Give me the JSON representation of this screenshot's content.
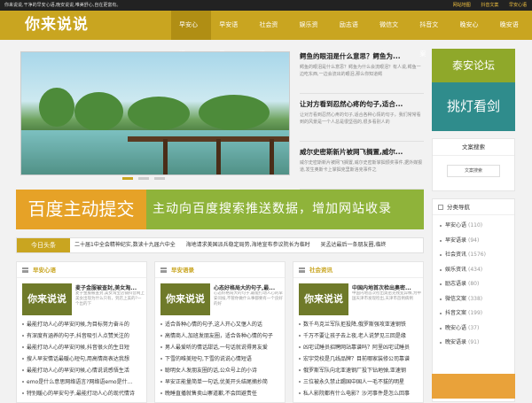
{
  "topbar": {
    "text": "你来说说,干净的早安心语,晚安说说,唯美舒心,自在更富有。",
    "links": [
      "网站地图",
      "抖音文案",
      "早安心语"
    ]
  },
  "logo": "你来说说",
  "nav": [
    "早安心语",
    "早安语录",
    "社会资讯",
    "娱乐资讯",
    "励志语录",
    "微信文案",
    "抖音文案",
    "晚安心语",
    "晚安语录"
  ],
  "news": [
    {
      "title": "鳄鱼的眼泪是什么意思？鳄鱼为...",
      "desc": "鳄鱼的眼泪是什么意思？鳄鱼为什么会流眼泪？有人说,鳄鱼一边吃东西,一边会流出的眼泪,那么你知道鳄"
    },
    {
      "title": "让对方看到忍然心疼的句子,适合...",
      "desc": "让对方看到忍然心疼的句子,适合各种心情的句子，我们常常看到的风景是一个人总是很坚强的,很多看别人的"
    },
    {
      "title": "威尔史密斯新片被网飞搁置,威尔...",
      "desc": "威尔史密斯新片被网飞搁置,威尔史密斯掌掴颁奖事件,据外媒报道,发生奥斯卡上掌掴克里斯洛克事件之"
    }
  ],
  "banner": {
    "left": "百度主动提交",
    "right": "主动向百度搜索推送数据，增加网站收录"
  },
  "ticker": {
    "label": "今日头条",
    "items": [
      "二十届1中全会精神纪实,数读十九届六中全",
      "海地请求美国派兵稳定局势,海地宣布参议院长为临时",
      "吴孟达最后一条朋友圈,临终"
    ]
  },
  "columns": [
    {
      "title": "早安心语",
      "thumb": "你来说说",
      "t": "麦子金服被查封,美女淘...",
      "d": "麦子金服被查封,美女淘宝店铺抖音网上美女出现为什么只有，到店上美的?一个出的下",
      "list": [
        "最能打动人心的早安问候,为目标努力奋斗的",
        "有深度有涵养的句子,抖音吸引人点赞关注的",
        "最能打动人心的早安问候,抖音很火的生日短",
        "搜人早安情话最暖心短句,用高情商表达我想",
        "最能打动人心的早安问候,心情说说感悟生活",
        "emo是什么意思网络语言?网络语emo是什...",
        "特别暖心的早安句子,最能打动人心的现代情诗"
      ]
    },
    {
      "title": "早安语录",
      "thumb": "你来说说",
      "t": "心态好格局大的句子,最...",
      "d": "心态好格局大的句子,最能打动人心的早安问候,不管你做什么事都要有一个良好的好",
      "list": [
        "适合各种心情的句子,这人开心又惬人的话",
        "高情商人,加班发朋友圈，适合各种心情的句子",
        "男人最爱听的情话甜话,一句话就说得男友爱",
        "下雪的唯美短句,下雪的说说心情短语",
        "聪明女人发朋友圈的话,公众号上的小诗",
        "早安正能量简单一句话,优美开头结尾摘抄简",
        "晚睡直播就售卖山寨道歉,不会回避责任"
      ]
    },
    {
      "title": "社会资讯",
      "thumb": "你来说说",
      "t": "中国内地首次检出奥密...",
      "d": "中国内地首次检出奥密克戎变异株,为中国天津市发现检出,天津市首例病例",
      "list": [
        "数千鸟克兰军队拒投降,俄罗斯强攻亚速钢铁",
        "千万不要让孩子去上夜,老人说梦见三回是缘",
        "凶宅试睡员招聘网站靠谱吗？阿里凶宅试睡员",
        "宏宇党校是几线品牌？目前哪家装修公司靠谱",
        "俄罗斯军队向北亚速钢厂投下钻地弹,亚速钢",
        "三位被永久禁止踢国中国人一毛不拔的明星",
        "私人影院都有什么电影？沙河事件是怎么回事"
      ]
    }
  ],
  "side": {
    "box1": "泰安论坛",
    "box2": "挑灯看剑",
    "search_title": "文案搜索",
    "search_label": "文案搜索",
    "cat_title": "分类导航",
    "cats": [
      {
        "n": "早安心语",
        "c": "(110)"
      },
      {
        "n": "早安语录",
        "c": "(94)"
      },
      {
        "n": "社会资讯",
        "c": "(1576)"
      },
      {
        "n": "娱乐资讯",
        "c": "(434)"
      },
      {
        "n": "励志语录",
        "c": "(80)"
      },
      {
        "n": "微信文案",
        "c": "(338)"
      },
      {
        "n": "抖音文案",
        "c": "(199)"
      },
      {
        "n": "晚安心语",
        "c": "(37)"
      },
      {
        "n": "晚安语录",
        "c": "(91)"
      }
    ]
  }
}
